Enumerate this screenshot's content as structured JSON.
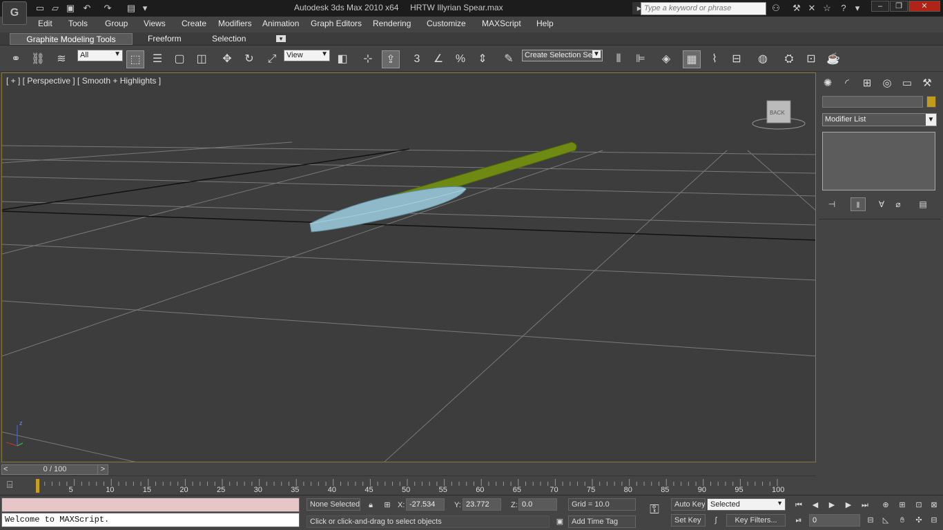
{
  "window": {
    "app_title": "Autodesk 3ds Max  2010 x64",
    "file_title": "HRTW Illyrian Spear.max",
    "search_placeholder": "Type a keyword or phrase"
  },
  "menubar": [
    "Edit",
    "Tools",
    "Group",
    "Views",
    "Create",
    "Modifiers",
    "Animation",
    "Graph Editors",
    "Rendering",
    "Customize",
    "MAXScript",
    "Help"
  ],
  "ribbon_tabs": [
    "Graphite Modeling Tools",
    "Freeform",
    "Selection"
  ],
  "toolbar": {
    "filter_dropdown": "All",
    "refcoord_dropdown": "View",
    "selection_set": "Create Selection Se",
    "snap_label": "3"
  },
  "viewport": {
    "label": "[ + ] [ Perspective ] [ Smooth + Highlights ]",
    "viewcube_label": "BACK",
    "axis_z": "z",
    "accent_color": "#8a7a3a"
  },
  "command_panel": {
    "modifier_list": "Modifier List",
    "object_color": "#c29a1c"
  },
  "timeline": {
    "slider_text": "0 / 100",
    "prev": "<",
    "next": ">",
    "ticks": [
      "0",
      "5",
      "10",
      "15",
      "20",
      "25",
      "30",
      "35",
      "40",
      "45",
      "50",
      "55",
      "60",
      "65",
      "70",
      "75",
      "80",
      "85",
      "90",
      "95",
      "100"
    ]
  },
  "status": {
    "maxscript_output": "Welcome to MAXScript.",
    "selection": "None Selected",
    "prompt": "Click or click-and-drag to select objects",
    "x_label": "X:",
    "x_value": "-27.534",
    "y_label": "Y:",
    "y_value": "23.772",
    "z_label": "Z:",
    "z_value": "0.0",
    "grid": "Grid = 10.0",
    "add_time_tag": "Add Time Tag",
    "auto_key": "Auto Key",
    "set_key": "Set Key",
    "key_mode": "Selected",
    "key_filters": "Key Filters...",
    "frame": "0"
  }
}
